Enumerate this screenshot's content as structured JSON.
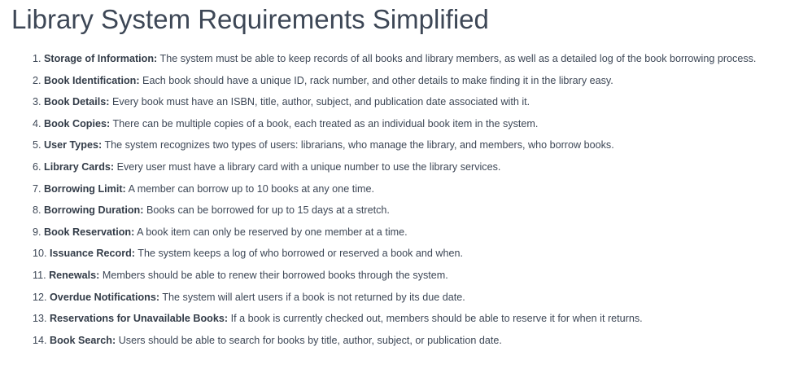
{
  "title": "Library System Requirements Simplified",
  "requirements": [
    {
      "number": "1.",
      "term": "Storage of Information:",
      "text": " The system must be able to keep records of all books and library members, as well as a detailed log of the book borrowing process."
    },
    {
      "number": "2.",
      "term": "Book Identification:",
      "text": " Each book should have a unique ID, rack number, and other details to make finding it in the library easy."
    },
    {
      "number": "3.",
      "term": "Book Details:",
      "text": " Every book must have an ISBN, title, author, subject, and publication date associated with it."
    },
    {
      "number": "4.",
      "term": "Book Copies:",
      "text": " There can be multiple copies of a book, each treated as an individual book item in the system."
    },
    {
      "number": "5.",
      "term": "User Types:",
      "text": " The system recognizes two types of users: librarians, who manage the library, and members, who borrow books."
    },
    {
      "number": "6.",
      "term": "Library Cards:",
      "text": " Every user must have a library card with a unique number to use the library services."
    },
    {
      "number": "7.",
      "term": "Borrowing Limit:",
      "text": " A member can borrow up to 10 books at any one time."
    },
    {
      "number": "8.",
      "term": "Borrowing Duration:",
      "text": " Books can be borrowed for up to 15 days at a stretch."
    },
    {
      "number": "9.",
      "term": "Book Reservation:",
      "text": " A book item can only be reserved by one member at a time."
    },
    {
      "number": "10.",
      "term": "Issuance Record:",
      "text": " The system keeps a log of who borrowed or reserved a book and when."
    },
    {
      "number": "11.",
      "term": "Renewals:",
      "text": " Members should be able to renew their borrowed books through the system."
    },
    {
      "number": "12.",
      "term": "Overdue Notifications:",
      "text": " The system will alert users if a book is not returned by its due date."
    },
    {
      "number": "13.",
      "term": "Reservations for Unavailable Books:",
      "text": " If a book is currently checked out, members should be able to reserve it for when it returns."
    },
    {
      "number": "14.",
      "term": "Book Search:",
      "text": " Users should be able to search for books by title, author, subject, or publication date."
    }
  ]
}
